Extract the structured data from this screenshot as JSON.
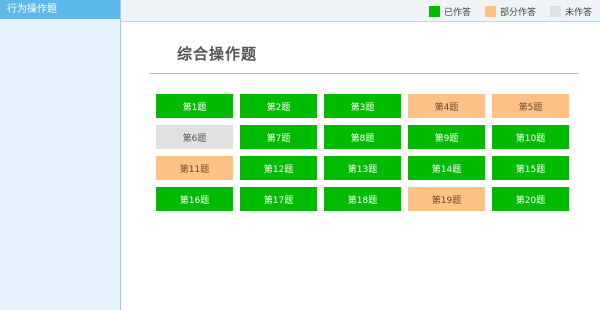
{
  "sidebar": {
    "header": "行为操作题"
  },
  "legend": [
    {
      "label": "已作答",
      "color": "#00bb00"
    },
    {
      "label": "部分作答",
      "color": "#ffc184"
    },
    {
      "label": "未作答",
      "color": "#e1e1e1"
    }
  ],
  "main": {
    "title": "综合操作题"
  },
  "questions": [
    {
      "label": "第1题",
      "status": "done"
    },
    {
      "label": "第2题",
      "status": "done"
    },
    {
      "label": "第3题",
      "status": "done"
    },
    {
      "label": "第4题",
      "status": "partial"
    },
    {
      "label": "第5题",
      "status": "partial"
    },
    {
      "label": "第6题",
      "status": "none"
    },
    {
      "label": "第7题",
      "status": "done"
    },
    {
      "label": "第8题",
      "status": "done"
    },
    {
      "label": "第9题",
      "status": "done"
    },
    {
      "label": "第10题",
      "status": "done"
    },
    {
      "label": "第11题",
      "status": "partial"
    },
    {
      "label": "第12题",
      "status": "done"
    },
    {
      "label": "第13题",
      "status": "done"
    },
    {
      "label": "第14题",
      "status": "done"
    },
    {
      "label": "第15题",
      "status": "done"
    },
    {
      "label": "第16题",
      "status": "done"
    },
    {
      "label": "第17题",
      "status": "done"
    },
    {
      "label": "第18题",
      "status": "done"
    },
    {
      "label": "第19题",
      "status": "partial"
    },
    {
      "label": "第20题",
      "status": "done"
    }
  ]
}
